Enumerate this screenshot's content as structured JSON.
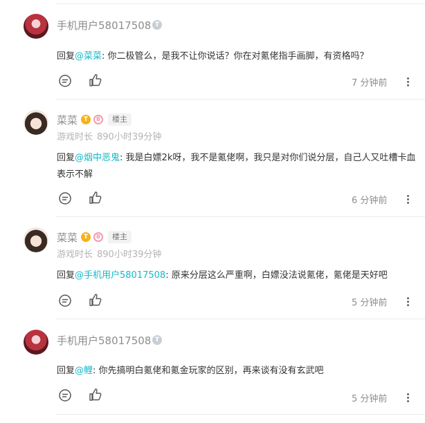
{
  "comments": [
    {
      "user": "手机用户58017508",
      "level_badge": "T",
      "reply_prefix": "回复",
      "mention": "@菜菜",
      "text": ": 你二极管么，是我不让你说话？你在对氪佬指手画脚，有资格吗？",
      "time": "7 分钟前"
    },
    {
      "user": "菜菜",
      "level_badge": "T",
      "fan_badge": "B",
      "owner_tag": "楼主",
      "playtime_label": "游戏时长",
      "playtime_value": "890小时39分钟",
      "reply_prefix": "回复",
      "mention": "@烟中恶鬼",
      "text": ": 我是白嫖2k呀，我不是氪佬啊，我只是对你们说分层，自己人又吐槽卡血表示不解",
      "time": "6 分钟前"
    },
    {
      "user": "菜菜",
      "level_badge": "T",
      "fan_badge": "B",
      "owner_tag": "楼主",
      "playtime_label": "游戏时长",
      "playtime_value": "890小时39分钟",
      "reply_prefix": "回复",
      "mention": "@手机用户58017508",
      "text": ": 原来分层这么严重啊，白嫖没法说氪佬，氪佬是天好吧",
      "time": "5 分钟前"
    },
    {
      "user": "手机用户58017508",
      "level_badge": "T",
      "reply_prefix": "回复",
      "mention": "@鲤",
      "text": ": 你先搞明白氪佬和氪金玩家的区别，再来谈有没有玄武吧",
      "time": "5 分钟前"
    }
  ],
  "colors": {
    "link": "#14b9c8",
    "name": "#8d8d8d",
    "owner_tag_bg": "#f3f3f3"
  },
  "icons": [
    "comment-icon",
    "like-icon",
    "more-icon"
  ]
}
